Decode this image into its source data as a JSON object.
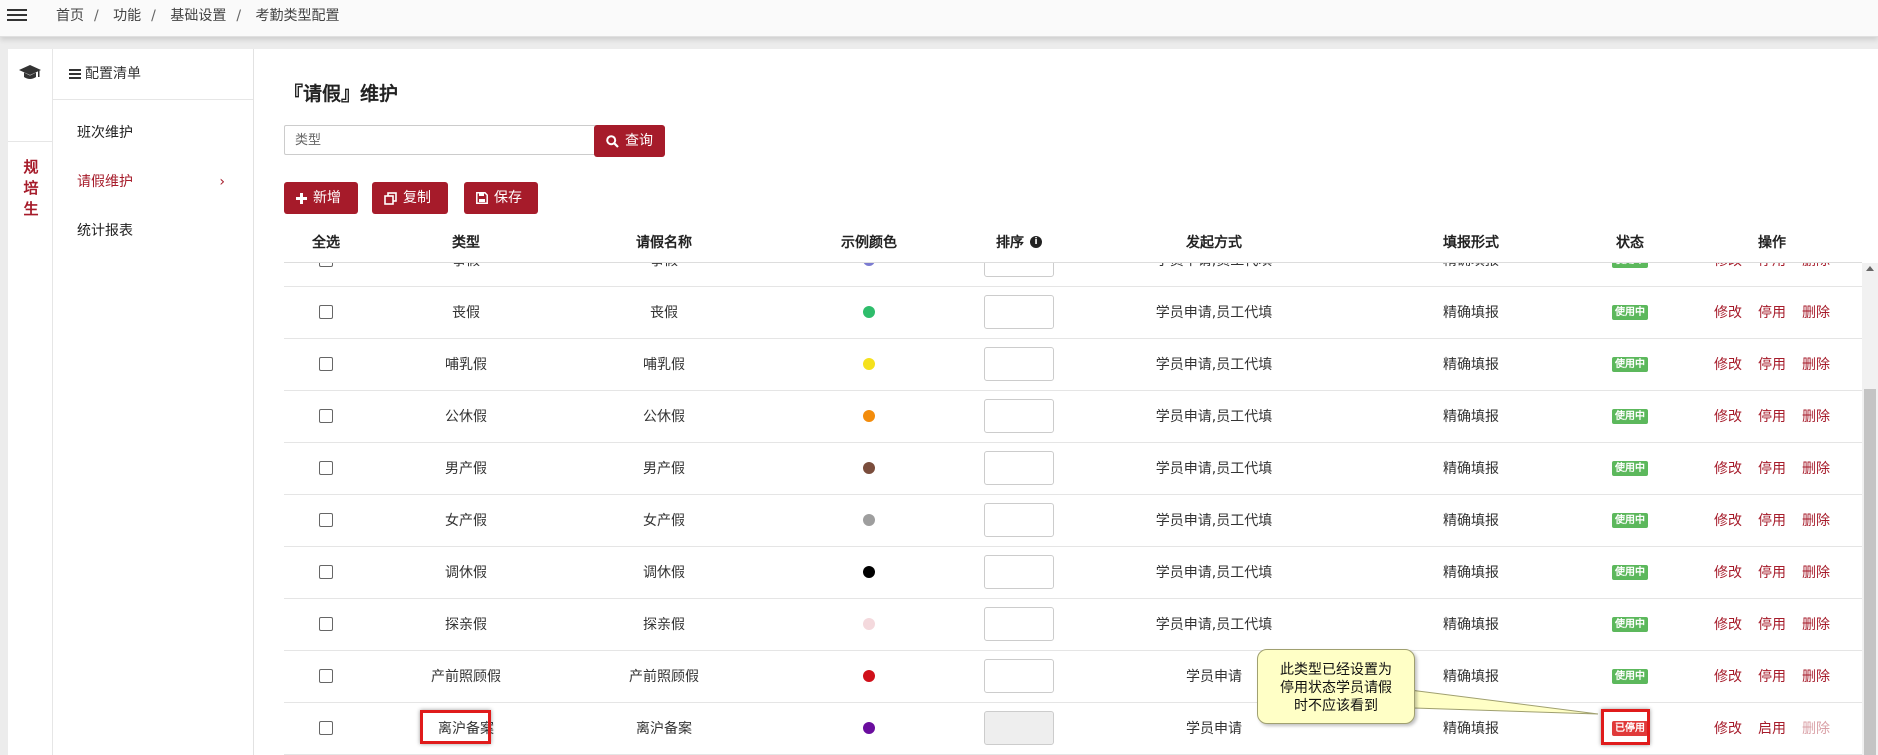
{
  "breadcrumb": [
    "首页",
    "功能",
    "基础设置",
    "考勤类型配置"
  ],
  "rail": {
    "label_chars": [
      "规",
      "培",
      "生"
    ]
  },
  "config_panel": {
    "title": "配置清单",
    "items": [
      {
        "label": "班次维护",
        "active": false
      },
      {
        "label": "请假维护",
        "active": true
      },
      {
        "label": "统计报表",
        "active": false
      }
    ]
  },
  "page": {
    "title": "『请假』维护",
    "search": {
      "placeholder": "类型",
      "value": ""
    },
    "query_button": "查询",
    "toolbar": {
      "add": "新增",
      "copy": "复制",
      "save": "保存"
    }
  },
  "table": {
    "headers": {
      "select_all": "全选",
      "type": "类型",
      "name": "请假名称",
      "color": "示例颜色",
      "sort": "排序",
      "launch": "发起方式",
      "fill": "填报形式",
      "status": "状态",
      "ops": "操作"
    },
    "rows": [
      {
        "type": "事假",
        "name": "事假",
        "color": "#7b7bd1",
        "launch": "学员申请,员工代填",
        "fill": "精确填报",
        "status": "使用中",
        "ops": [
          "修改",
          "停用",
          "删除"
        ],
        "disabled": false
      },
      {
        "type": "丧假",
        "name": "丧假",
        "color": "#2ebd6b",
        "launch": "学员申请,员工代填",
        "fill": "精确填报",
        "status": "使用中",
        "ops": [
          "修改",
          "停用",
          "删除"
        ],
        "disabled": false
      },
      {
        "type": "哺乳假",
        "name": "哺乳假",
        "color": "#f5e11d",
        "launch": "学员申请,员工代填",
        "fill": "精确填报",
        "status": "使用中",
        "ops": [
          "修改",
          "停用",
          "删除"
        ],
        "disabled": false
      },
      {
        "type": "公休假",
        "name": "公休假",
        "color": "#f38c0c",
        "launch": "学员申请,员工代填",
        "fill": "精确填报",
        "status": "使用中",
        "ops": [
          "修改",
          "停用",
          "删除"
        ],
        "disabled": false
      },
      {
        "type": "男产假",
        "name": "男产假",
        "color": "#7a4d3c",
        "launch": "学员申请,员工代填",
        "fill": "精确填报",
        "status": "使用中",
        "ops": [
          "修改",
          "停用",
          "删除"
        ],
        "disabled": false
      },
      {
        "type": "女产假",
        "name": "女产假",
        "color": "#9e9e9e",
        "launch": "学员申请,员工代填",
        "fill": "精确填报",
        "status": "使用中",
        "ops": [
          "修改",
          "停用",
          "删除"
        ],
        "disabled": false
      },
      {
        "type": "调休假",
        "name": "调休假",
        "color": "#000000",
        "launch": "学员申请,员工代填",
        "fill": "精确填报",
        "status": "使用中",
        "ops": [
          "修改",
          "停用",
          "删除"
        ],
        "disabled": false
      },
      {
        "type": "探亲假",
        "name": "探亲假",
        "color": "#f4d9dd",
        "launch": "学员申请,员工代填",
        "fill": "精确填报",
        "status": "使用中",
        "ops": [
          "修改",
          "停用",
          "删除"
        ],
        "disabled": false
      },
      {
        "type": "产前照顾假",
        "name": "产前照顾假",
        "color": "#d0101a",
        "launch": "学员申请",
        "fill": "精确填报",
        "status": "使用中",
        "ops": [
          "修改",
          "停用",
          "删除"
        ],
        "disabled": false
      },
      {
        "type": "离沪备案",
        "name": "离沪备案",
        "color": "#6a0d9e",
        "launch": "学员申请",
        "fill": "精确填报",
        "status": "已停用",
        "ops": [
          "修改",
          "启用",
          "删除"
        ],
        "disabled": true
      }
    ]
  },
  "status_colors": {
    "active": "#5cb85c",
    "disabled": "#e03a3a"
  },
  "callout": {
    "lines": [
      "此类型已经设置为",
      "停用状态学员请假",
      "时不应该看到"
    ]
  }
}
